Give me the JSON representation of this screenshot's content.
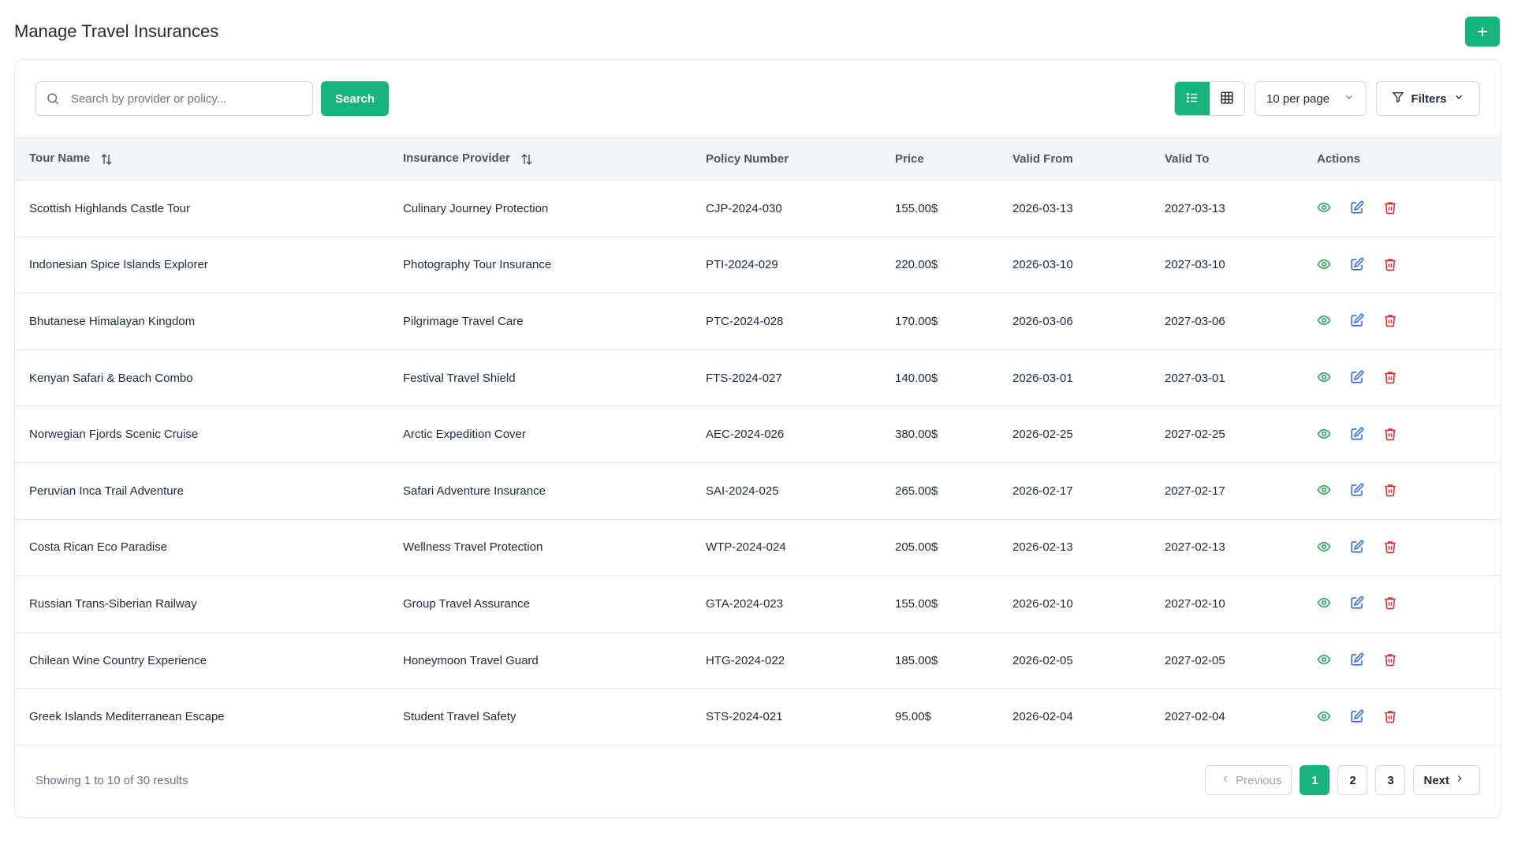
{
  "header": {
    "title": "Manage Travel Insurances",
    "add_icon": "plus-icon"
  },
  "toolbar": {
    "search_placeholder": "Search by provider or policy...",
    "search_value": "",
    "search_label": "Search",
    "per_page": "10 per page",
    "filters_label": "Filters",
    "active_view": "list"
  },
  "table": {
    "columns": [
      "Tour Name",
      "Insurance Provider",
      "Policy Number",
      "Price",
      "Valid From",
      "Valid To",
      "Actions"
    ],
    "rows": [
      {
        "tour": "Scottish Highlands Castle Tour",
        "provider": "Culinary Journey Protection",
        "policy": "CJP-2024-030",
        "price": "155.00$",
        "from": "2026-03-13",
        "to": "2027-03-13"
      },
      {
        "tour": "Indonesian Spice Islands Explorer",
        "provider": "Photography Tour Insurance",
        "policy": "PTI-2024-029",
        "price": "220.00$",
        "from": "2026-03-10",
        "to": "2027-03-10"
      },
      {
        "tour": "Bhutanese Himalayan Kingdom",
        "provider": "Pilgrimage Travel Care",
        "policy": "PTC-2024-028",
        "price": "170.00$",
        "from": "2026-03-06",
        "to": "2027-03-06"
      },
      {
        "tour": "Kenyan Safari & Beach Combo",
        "provider": "Festival Travel Shield",
        "policy": "FTS-2024-027",
        "price": "140.00$",
        "from": "2026-03-01",
        "to": "2027-03-01"
      },
      {
        "tour": "Norwegian Fjords Scenic Cruise",
        "provider": "Arctic Expedition Cover",
        "policy": "AEC-2024-026",
        "price": "380.00$",
        "from": "2026-02-25",
        "to": "2027-02-25"
      },
      {
        "tour": "Peruvian Inca Trail Adventure",
        "provider": "Safari Adventure Insurance",
        "policy": "SAI-2024-025",
        "price": "265.00$",
        "from": "2026-02-17",
        "to": "2027-02-17"
      },
      {
        "tour": "Costa Rican Eco Paradise",
        "provider": "Wellness Travel Protection",
        "policy": "WTP-2024-024",
        "price": "205.00$",
        "from": "2026-02-13",
        "to": "2027-02-13"
      },
      {
        "tour": "Russian Trans-Siberian Railway",
        "provider": "Group Travel Assurance",
        "policy": "GTA-2024-023",
        "price": "155.00$",
        "from": "2026-02-10",
        "to": "2027-02-10"
      },
      {
        "tour": "Chilean Wine Country Experience",
        "provider": "Honeymoon Travel Guard",
        "policy": "HTG-2024-022",
        "price": "185.00$",
        "from": "2026-02-05",
        "to": "2027-02-05"
      },
      {
        "tour": "Greek Islands Mediterranean Escape",
        "provider": "Student Travel Safety",
        "policy": "STS-2024-021",
        "price": "95.00$",
        "from": "2026-02-04",
        "to": "2027-02-04"
      }
    ]
  },
  "footer": {
    "summary": "Showing 1 to 10 of 30 results",
    "previous_label": "Previous",
    "next_label": "Next",
    "pages": [
      "1",
      "2",
      "3"
    ],
    "current_page": "1"
  },
  "colors": {
    "accent": "#16b37e",
    "view_icon": "#16a34a",
    "edit_icon": "#2563eb",
    "delete_icon": "#dc2626"
  }
}
